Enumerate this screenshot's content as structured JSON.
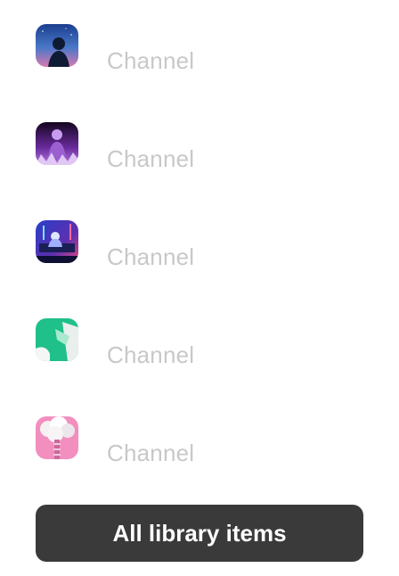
{
  "library": {
    "items": [
      {
        "label": "Channel",
        "artwork": "night-sky-silhouette-artwork"
      },
      {
        "label": "Channel",
        "artwork": "purple-concert-crowd-artwork"
      },
      {
        "label": "Channel",
        "artwork": "neon-dj-stage-artwork"
      },
      {
        "label": "Channel",
        "artwork": "green-abstract-shapes-artwork"
      },
      {
        "label": "Channel",
        "artwork": "pink-cloud-tower-artwork"
      }
    ],
    "label_color": "#c8c8c8"
  },
  "footer": {
    "all_items_label": "All library items",
    "button_color": "#3a3a3a"
  }
}
